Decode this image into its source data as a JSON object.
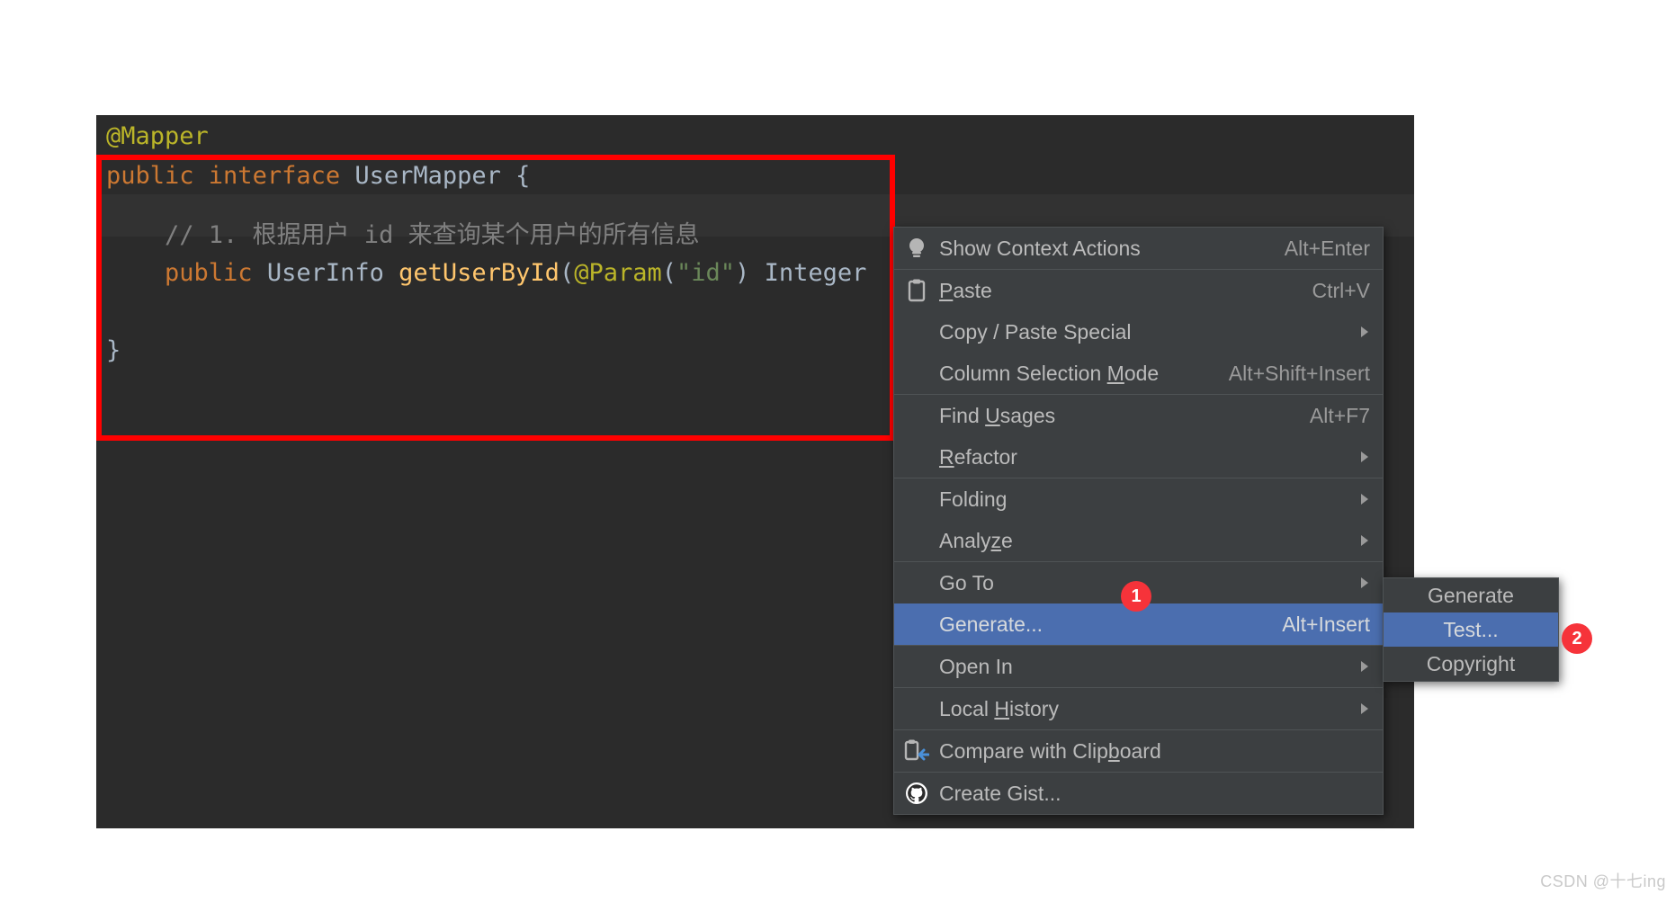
{
  "editor": {
    "background_color": "#2b2b2b",
    "lines": [
      {
        "id": "l1",
        "tokens": [
          {
            "t": "@Mapper",
            "c": "ann"
          }
        ]
      },
      {
        "id": "l2",
        "tokens": [
          {
            "t": "public ",
            "c": "kw"
          },
          {
            "t": "interface ",
            "c": "kw"
          },
          {
            "t": "UserMapper",
            "c": "cls"
          },
          {
            "t": " {",
            "c": "plain"
          }
        ]
      },
      {
        "id": "l3",
        "tokens": [
          {
            "t": "",
            "c": "plain"
          }
        ]
      },
      {
        "id": "l4",
        "tokens": [
          {
            "t": "    // 1. 根据用户 id 来查询某个用户的所有信息",
            "c": "cmt"
          }
        ]
      },
      {
        "id": "l5",
        "tokens": [
          {
            "t": "    public ",
            "c": "kw"
          },
          {
            "t": "UserInfo ",
            "c": "cls"
          },
          {
            "t": "getUserById",
            "c": "mth"
          },
          {
            "t": "(",
            "c": "plain"
          },
          {
            "t": "@Param",
            "c": "ann"
          },
          {
            "t": "(",
            "c": "plain"
          },
          {
            "t": "\"id\"",
            "c": "str"
          },
          {
            "t": ") ",
            "c": "plain"
          },
          {
            "t": "Integer",
            "c": "cls"
          }
        ]
      },
      {
        "id": "l6",
        "tokens": [
          {
            "t": "",
            "c": "plain"
          }
        ]
      },
      {
        "id": "l7",
        "tokens": [
          {
            "t": "}",
            "c": "plain"
          }
        ]
      }
    ]
  },
  "annotation": {
    "red_box_color": "#ff0000",
    "badge_color": "#f6333a",
    "badges": [
      {
        "id": "badge-1",
        "label": "1"
      },
      {
        "id": "badge-2",
        "label": "2"
      }
    ]
  },
  "context_menu": {
    "highlight_color": "#4b6eaf",
    "background_color": "#3c3f41",
    "items": [
      {
        "icon": "lightbulb-icon",
        "label": "Show Context Actions",
        "shortcut": "Alt+Enter",
        "arrow": false,
        "selected": false,
        "mnemonic": ""
      },
      {
        "separator": true
      },
      {
        "icon": "clipboard-icon",
        "label": "Paste",
        "shortcut": "Ctrl+V",
        "arrow": false,
        "selected": false,
        "mnemonic": "P"
      },
      {
        "icon": "",
        "label": "Copy / Paste Special",
        "shortcut": "",
        "arrow": true,
        "selected": false,
        "mnemonic": ""
      },
      {
        "icon": "",
        "label": "Column Selection Mode",
        "shortcut": "Alt+Shift+Insert",
        "arrow": false,
        "selected": false,
        "mnemonic": "M"
      },
      {
        "separator": true
      },
      {
        "icon": "",
        "label": "Find Usages",
        "shortcut": "Alt+F7",
        "arrow": false,
        "selected": false,
        "mnemonic": "U"
      },
      {
        "icon": "",
        "label": "Refactor",
        "shortcut": "",
        "arrow": true,
        "selected": false,
        "mnemonic": "R"
      },
      {
        "separator": true
      },
      {
        "icon": "",
        "label": "Folding",
        "shortcut": "",
        "arrow": true,
        "selected": false,
        "mnemonic": ""
      },
      {
        "icon": "",
        "label": "Analyze",
        "shortcut": "",
        "arrow": true,
        "selected": false,
        "mnemonic": "z"
      },
      {
        "separator": true
      },
      {
        "icon": "",
        "label": "Go To",
        "shortcut": "",
        "arrow": true,
        "selected": false,
        "mnemonic": ""
      },
      {
        "icon": "",
        "label": "Generate...",
        "shortcut": "Alt+Insert",
        "arrow": false,
        "selected": true,
        "mnemonic": ""
      },
      {
        "separator": true
      },
      {
        "icon": "",
        "label": "Open In",
        "shortcut": "",
        "arrow": true,
        "selected": false,
        "mnemonic": ""
      },
      {
        "separator": true
      },
      {
        "icon": "",
        "label": "Local History",
        "shortcut": "",
        "arrow": true,
        "selected": false,
        "mnemonic": "H"
      },
      {
        "separator": true
      },
      {
        "icon": "compare-clipboard-icon",
        "label": "Compare with Clipboard",
        "shortcut": "",
        "arrow": false,
        "selected": false,
        "mnemonic": "b"
      },
      {
        "separator": true
      },
      {
        "icon": "github-icon",
        "label": "Create Gist...",
        "shortcut": "",
        "arrow": false,
        "selected": false,
        "mnemonic": ""
      }
    ]
  },
  "submenu": {
    "items": [
      {
        "label": "Generate",
        "selected": false
      },
      {
        "label": "Test...",
        "selected": true
      },
      {
        "label": "Copyright",
        "selected": false
      }
    ]
  },
  "watermark": {
    "text": "CSDN @十七ing"
  }
}
